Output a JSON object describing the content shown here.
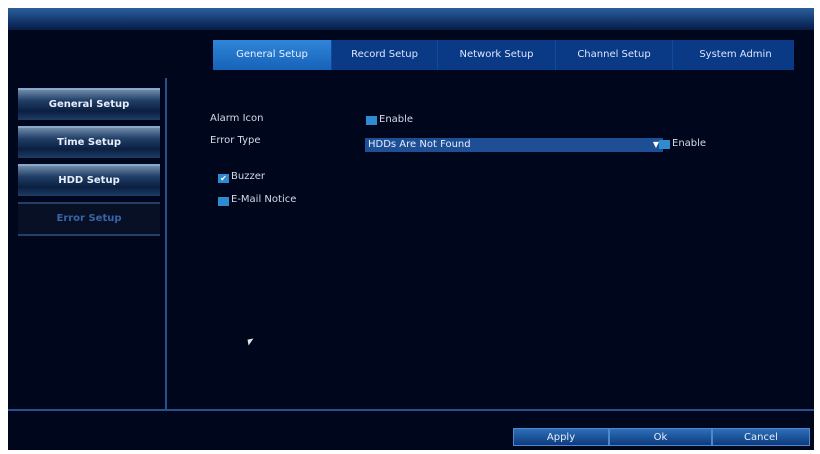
{
  "tabs": [
    {
      "label": "General Setup",
      "active": true
    },
    {
      "label": "Record Setup",
      "active": false
    },
    {
      "label": "Network Setup",
      "active": false
    },
    {
      "label": "Channel Setup",
      "active": false
    },
    {
      "label": "System Admin",
      "active": false
    }
  ],
  "sidebar": {
    "items": [
      {
        "label": "General Setup"
      },
      {
        "label": "Time Setup"
      },
      {
        "label": "HDD Setup"
      },
      {
        "label": "Error Setup"
      }
    ]
  },
  "form": {
    "alarm_icon_label": "Alarm Icon",
    "alarm_icon_enable": "Enable",
    "error_type_label": "Error Type",
    "error_type_value": "HDDs Are Not Found",
    "error_type_enable": "Enable",
    "buzzer_label": "Buzzer",
    "buzzer_checked": true,
    "email_label": "E-Mail Notice",
    "email_checked": false
  },
  "buttons": {
    "apply": "Apply",
    "ok": "Ok",
    "cancel": "Cancel"
  },
  "colors": {
    "background": "#00061b",
    "tab_active": "#1f74c8",
    "checkbox": "#2e8bd0"
  }
}
